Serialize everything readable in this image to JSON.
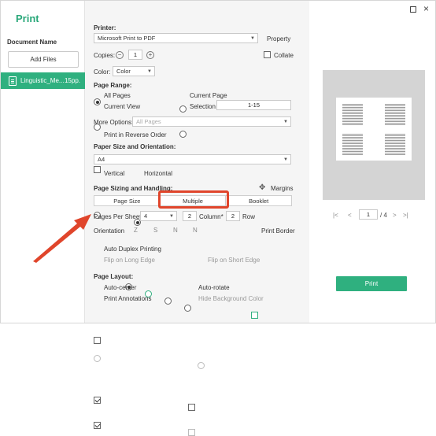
{
  "window": {
    "title": "Print"
  },
  "sidebar": {
    "section_label": "Document Name",
    "add_files_label": "Add Files",
    "document": {
      "name": "Linguistic_Me...",
      "pages": "15pp."
    }
  },
  "printer": {
    "label": "Printer:",
    "selected": "Microsoft Print to PDF",
    "property_label": "Property",
    "copies_label": "Copies:",
    "copies_value": "1",
    "collate_label": "Collate",
    "color_label": "Color:",
    "color_selected": "Color"
  },
  "page_range": {
    "label": "Page Range:",
    "all_pages": "All Pages",
    "current_page": "Current Page",
    "current_view": "Current View",
    "selection": "Selection",
    "selection_range": "1-15",
    "more_options_label": "More Options:",
    "more_options_value": "All Pages",
    "reverse_label": "Print in Reverse Order"
  },
  "paper": {
    "label": "Paper Size and Orientation:",
    "size": "A4",
    "vertical": "Vertical",
    "horizontal": "Horizontal"
  },
  "sizing": {
    "label": "Page Sizing and Handling:",
    "margins_label": "Margins",
    "tabs": [
      "Page Size",
      "Multiple",
      "Booklet"
    ],
    "pages_per_sheet_label": "Pages Per Sheet :",
    "pages_per_sheet_value": "4",
    "columns_value": "2",
    "column_label": "Column*",
    "rows_value": "2",
    "row_label": "Row",
    "orientation_label": "Orientation",
    "orient_glyphs": [
      "Z",
      "S",
      "N",
      "N"
    ],
    "print_border_label": "Print Border",
    "duplex_label": "Auto Duplex Printing",
    "long_edge_label": "Flip on Long Edge",
    "short_edge_label": "Flip on Short Edge"
  },
  "layout": {
    "label": "Page Layout:",
    "auto_center": "Auto-center",
    "auto_rotate": "Auto-rotate",
    "print_annotations": "Print Annotations",
    "hide_bg": "Hide Background Color"
  },
  "preview": {
    "current_page": "1",
    "total_pages": "/ 4"
  },
  "print_button_label": "Print",
  "colors": {
    "accent": "#2fb07f",
    "highlight": "#e0452b"
  }
}
